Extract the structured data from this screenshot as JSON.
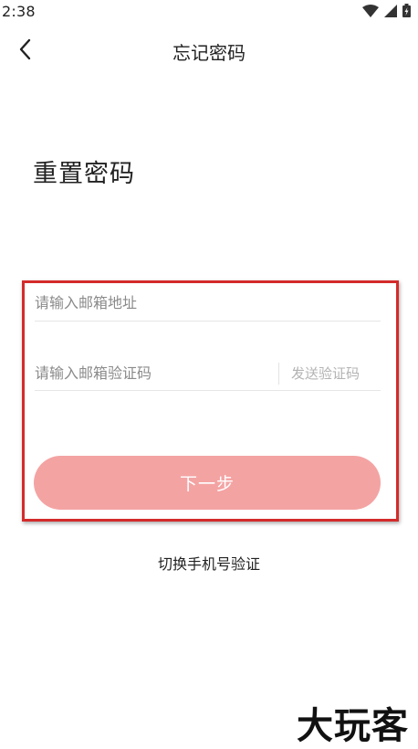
{
  "status_bar": {
    "time": "2:38",
    "icons": [
      "wifi-icon",
      "signal-icon",
      "battery-icon"
    ]
  },
  "nav": {
    "back_icon": "chevron-left-icon",
    "title": "忘记密码"
  },
  "heading": "重置密码",
  "form": {
    "email_placeholder": "请输入邮箱地址",
    "email_value": "",
    "code_placeholder": "请输入邮箱验证码",
    "code_value": "",
    "send_code_label": "发送验证码",
    "next_label": "下一步"
  },
  "switch_link": "切换手机号验证",
  "watermark": "大玩客",
  "colors": {
    "highlight_border": "#d42b2b",
    "button_bg": "#f4a3a3",
    "button_text": "#ffffff",
    "placeholder": "#8a8a8a",
    "send_code": "#b3b3b3"
  }
}
